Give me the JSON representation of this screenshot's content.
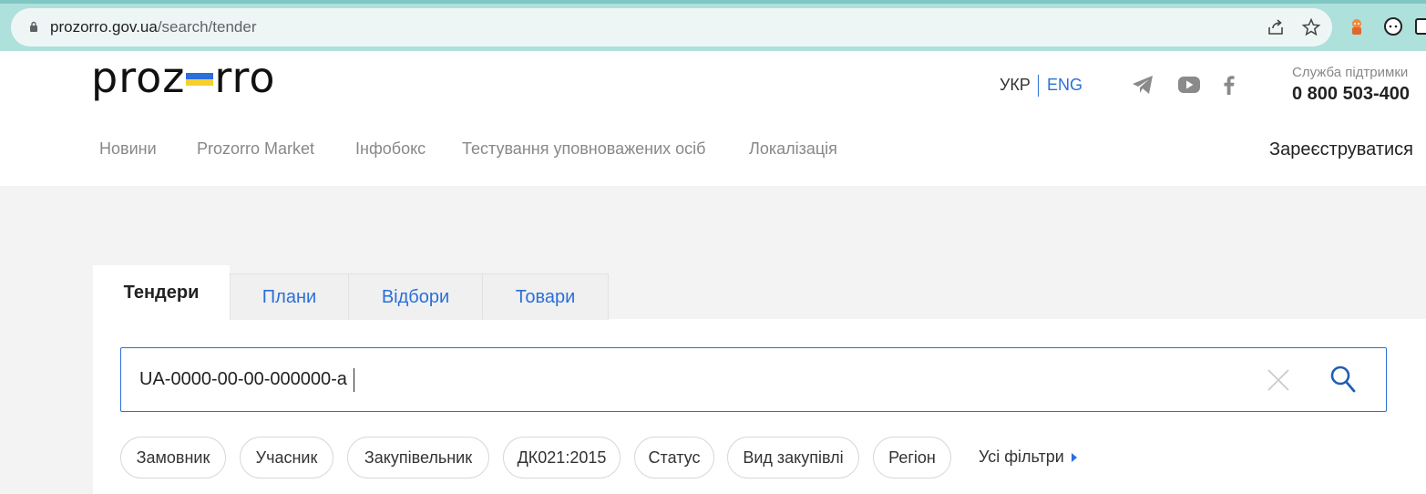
{
  "browser": {
    "url_host": "prozorro.gov.ua",
    "url_path": "/search/tender"
  },
  "header": {
    "logo_before": "proz",
    "logo_after": "rro",
    "lang_ukr": "УКР",
    "lang_eng": "ENG",
    "support_label": "Служба підтримки",
    "support_phone": "0 800 503-400",
    "social": [
      "telegram-icon",
      "youtube-icon",
      "facebook-icon"
    ]
  },
  "nav": {
    "items": [
      "Новини",
      "Prozorro Market",
      "Інфобокс",
      "Тестування уповноважених осіб",
      "Локалізація"
    ],
    "register": "Зареєструватися"
  },
  "search": {
    "tabs": [
      "Тендери",
      "Плани",
      "Відбори",
      "Товари"
    ],
    "active_tab": "Тендери",
    "query": "UA-0000-00-00-000000-a",
    "filters": [
      "Замовник",
      "Учасник",
      "Закупівельник",
      "ДК021:2015",
      "Статус",
      "Вид закупівлі",
      "Регіон"
    ],
    "all_filters": "Усі фільтри"
  },
  "colors": {
    "accent": "#2b6fd8",
    "flag_blue": "#2b6fd8",
    "flag_yellow": "#f6d02f",
    "chrome": "#aee0dc"
  }
}
